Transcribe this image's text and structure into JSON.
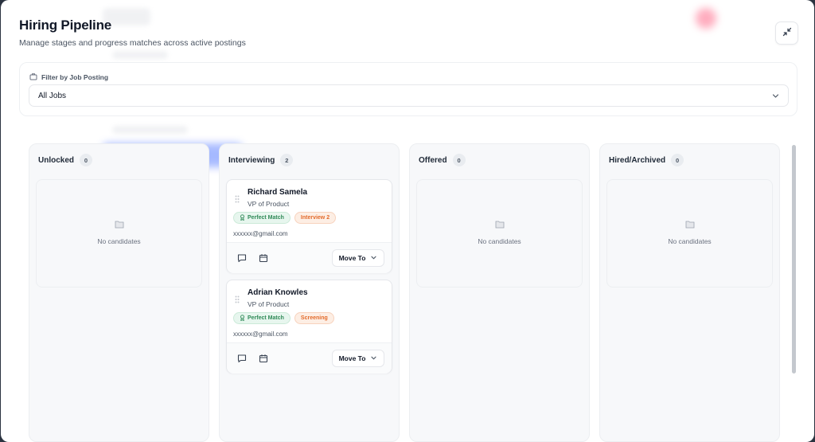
{
  "header": {
    "title": "Hiring Pipeline",
    "subtitle": "Manage stages and progress matches across active postings"
  },
  "filter": {
    "label": "Filter by Job Posting",
    "selected": "All Jobs"
  },
  "columns": [
    {
      "title": "Unlocked",
      "count": "0",
      "empty_text": "No candidates"
    },
    {
      "title": "Interviewing",
      "count": "2"
    },
    {
      "title": "Offered",
      "count": "0",
      "empty_text": "No candidates"
    },
    {
      "title": "Hired/Archived",
      "count": "0",
      "empty_text": "No candidates"
    }
  ],
  "candidates": [
    {
      "name": "Richard Samela",
      "role": "VP of Product",
      "match_tag": "Perfect Match",
      "stage_tag": "Interview 2",
      "email": "xxxxxx@gmail.com",
      "move_label": "Move To"
    },
    {
      "name": "Adrian Knowles",
      "role": "VP of Product",
      "match_tag": "Perfect Match",
      "stage_tag": "Screening",
      "email": "xxxxxx@gmail.com",
      "move_label": "Move To"
    }
  ],
  "icons": {
    "collapse": "collapse-icon",
    "briefcase": "briefcase-icon",
    "chevron": "chevron-down-icon",
    "folder": "folder-icon",
    "drag": "drag-handle-icon",
    "award": "award-icon",
    "message": "message-icon",
    "calendar": "calendar-icon"
  },
  "colors": {
    "match_bg": "#e7f6ee",
    "match_text": "#2f8a57",
    "stage_bg": "#fdeee4",
    "stage_text": "#e36b2c"
  }
}
